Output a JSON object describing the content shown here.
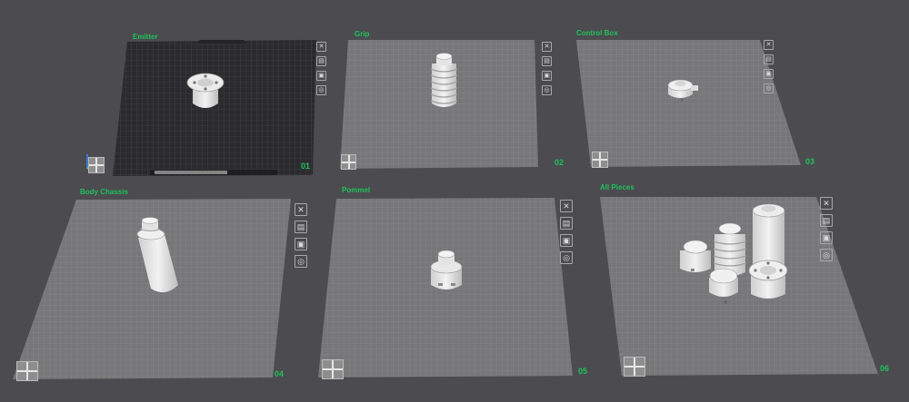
{
  "plates": [
    {
      "label": "Emitter",
      "number": "01"
    },
    {
      "label": "Grip",
      "number": "02"
    },
    {
      "label": "Control Box",
      "number": "03"
    },
    {
      "label": "Body  Chassis",
      "number": "04"
    },
    {
      "label": "Pommel",
      "number": "05"
    },
    {
      "label": "All Pieces",
      "number": "06"
    }
  ],
  "toolbar_icons": [
    "close-icon",
    "arrange-icon",
    "lock-icon",
    "settings-icon"
  ],
  "colors": {
    "background": "#4b4b50",
    "accent_green": "#21c25a",
    "active_plate": "#2d2d2f",
    "plate": "#777779"
  }
}
